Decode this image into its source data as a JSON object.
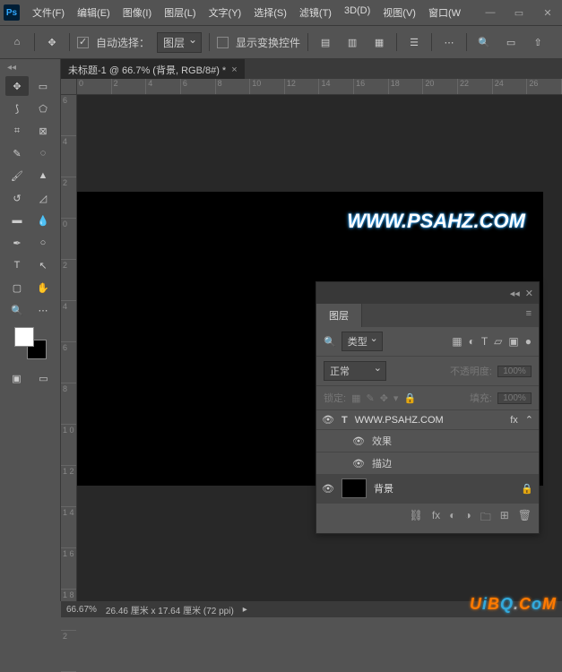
{
  "app": {
    "logo": "Ps"
  },
  "menu": {
    "file": "文件(F)",
    "edit": "编辑(E)",
    "image": "图像(I)",
    "layer": "图层(L)",
    "type": "文字(Y)",
    "select": "选择(S)",
    "filter": "滤镜(T)",
    "three_d": "3D(D)",
    "view": "视图(V)",
    "window": "窗口(W"
  },
  "options": {
    "auto_select_label": "自动选择：",
    "auto_select_value": "图层",
    "show_controls": "显示变换控件"
  },
  "document": {
    "tab_title": "未标题-1 @ 66.7% (背景, RGB/8#) *",
    "canvas_text": "WWW.PSAHZ.COM"
  },
  "ruler_h": [
    "0",
    "2",
    "4",
    "6",
    "8",
    "10",
    "12",
    "14",
    "16",
    "18",
    "20",
    "22",
    "24",
    "26"
  ],
  "ruler_v": [
    "6",
    "4",
    "2",
    "0",
    "2",
    "4",
    "6",
    "8",
    "1\n0",
    "1\n2",
    "1\n4",
    "1\n6",
    "1\n8",
    "2"
  ],
  "layers_panel": {
    "tab": "图层",
    "kind_search": "类型",
    "blend_mode": "正常",
    "opacity_label": "不透明度:",
    "opacity_value": "100%",
    "lock_label": "锁定:",
    "fill_label": "填充:",
    "fill_value": "100%",
    "items": [
      {
        "name": "WWW.PSAHZ.COM",
        "type": "T",
        "fx": "fx"
      },
      {
        "name": "效果",
        "sub": true
      },
      {
        "name": "描边",
        "sub": true
      },
      {
        "name": "背景",
        "type": "bg",
        "locked": true
      }
    ]
  },
  "status": {
    "zoom": "66.67%",
    "dims": "26.46 厘米 x 17.64 厘米 (72 ppi)"
  },
  "watermark": {
    "text": "UiBQ.CoM"
  },
  "colors": {
    "accent": "#31a8ff"
  }
}
